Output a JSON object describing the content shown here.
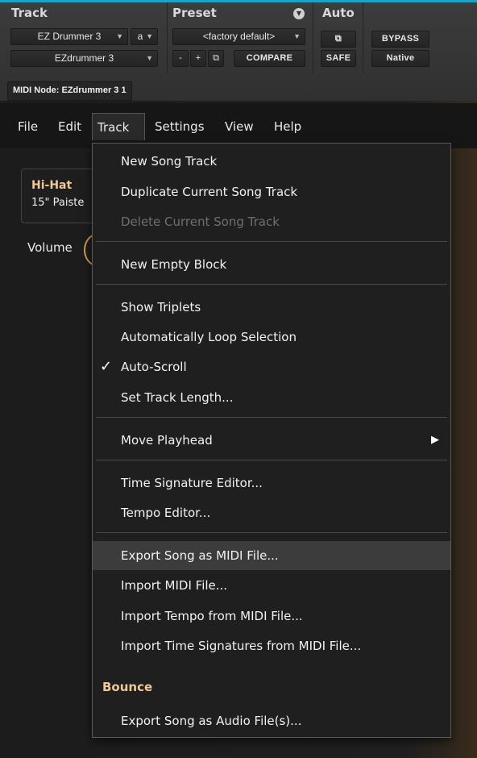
{
  "plugin": {
    "track_label": "Track",
    "preset_label": "Preset",
    "auto_label": "Auto",
    "track_name": "EZ Drummer 3",
    "track_channel": "a",
    "plugin_name": "EZdrummer 3",
    "preset_value": "<factory default>",
    "preset_minus": "-",
    "preset_plus": "+",
    "compare": "COMPARE",
    "bypass": "BYPASS",
    "safe": "SAFE",
    "native": "Native",
    "midi_node": "MIDI Node: EZdrummer 3 1"
  },
  "menubar": {
    "items": [
      "File",
      "Edit",
      "Track",
      "Settings",
      "View",
      "Help"
    ],
    "active": "Track"
  },
  "background": {
    "instrument_name": "Hi-Hat",
    "instrument_sub": "15\" Paiste",
    "volume_label": "Volume"
  },
  "track_menu": {
    "new_song_track": "New Song Track",
    "duplicate_song_track": "Duplicate Current Song Track",
    "delete_song_track": "Delete Current Song Track",
    "new_empty_block": "New Empty Block",
    "show_triplets": "Show Triplets",
    "auto_loop": "Automatically Loop Selection",
    "auto_scroll": "Auto-Scroll",
    "auto_scroll_checked": true,
    "set_track_length": "Set Track Length...",
    "move_playhead": "Move Playhead",
    "time_sig_editor": "Time Signature Editor...",
    "tempo_editor": "Tempo Editor...",
    "export_midi": "Export Song as MIDI File...",
    "import_midi": "Import MIDI File...",
    "import_tempo": "Import Tempo from MIDI File...",
    "import_time_sigs": "Import Time Signatures from MIDI File...",
    "bounce_header": "Bounce",
    "export_audio": "Export Song as Audio File(s)..."
  },
  "colors": {
    "accent_top": "#1aa3c8",
    "section_header": "#f0c89a",
    "knob_ring": "#d89a4a",
    "menu_bg": "#1f1f1f",
    "hover_bg": "#3c3c3c"
  },
  "icons": {
    "check": "checkmark-icon",
    "submenu": "triangle-right-icon",
    "preset_menu": "circle-chevron-down-icon",
    "link": "link-icon"
  }
}
